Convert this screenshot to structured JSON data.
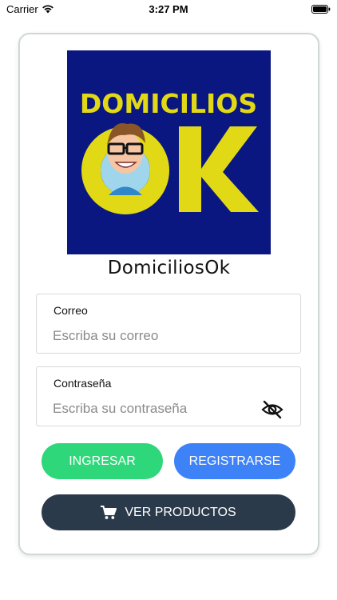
{
  "status_bar": {
    "carrier": "Carrier",
    "time": "3:27 PM"
  },
  "logo": {
    "line1": "DOMICILIOS",
    "line2_letter1": "O",
    "line2_letter2": "K",
    "background_color": "#0b1780",
    "text_color": "#e2d916"
  },
  "brand_name": "DomiciliosOk",
  "form": {
    "email": {
      "label": "Correo",
      "placeholder": "Escriba su correo",
      "value": ""
    },
    "password": {
      "label": "Contraseña",
      "placeholder": "Escriba su contraseña",
      "value": ""
    }
  },
  "buttons": {
    "login": "INGRESAR",
    "register": "REGISTRARSE",
    "products": "VER PRODUCTOS"
  },
  "colors": {
    "login": "#2ed77a",
    "register": "#3d82f6",
    "products": "#2b3a4b"
  },
  "icons": {
    "password_toggle": "eye-off-icon",
    "products": "cart-icon"
  }
}
